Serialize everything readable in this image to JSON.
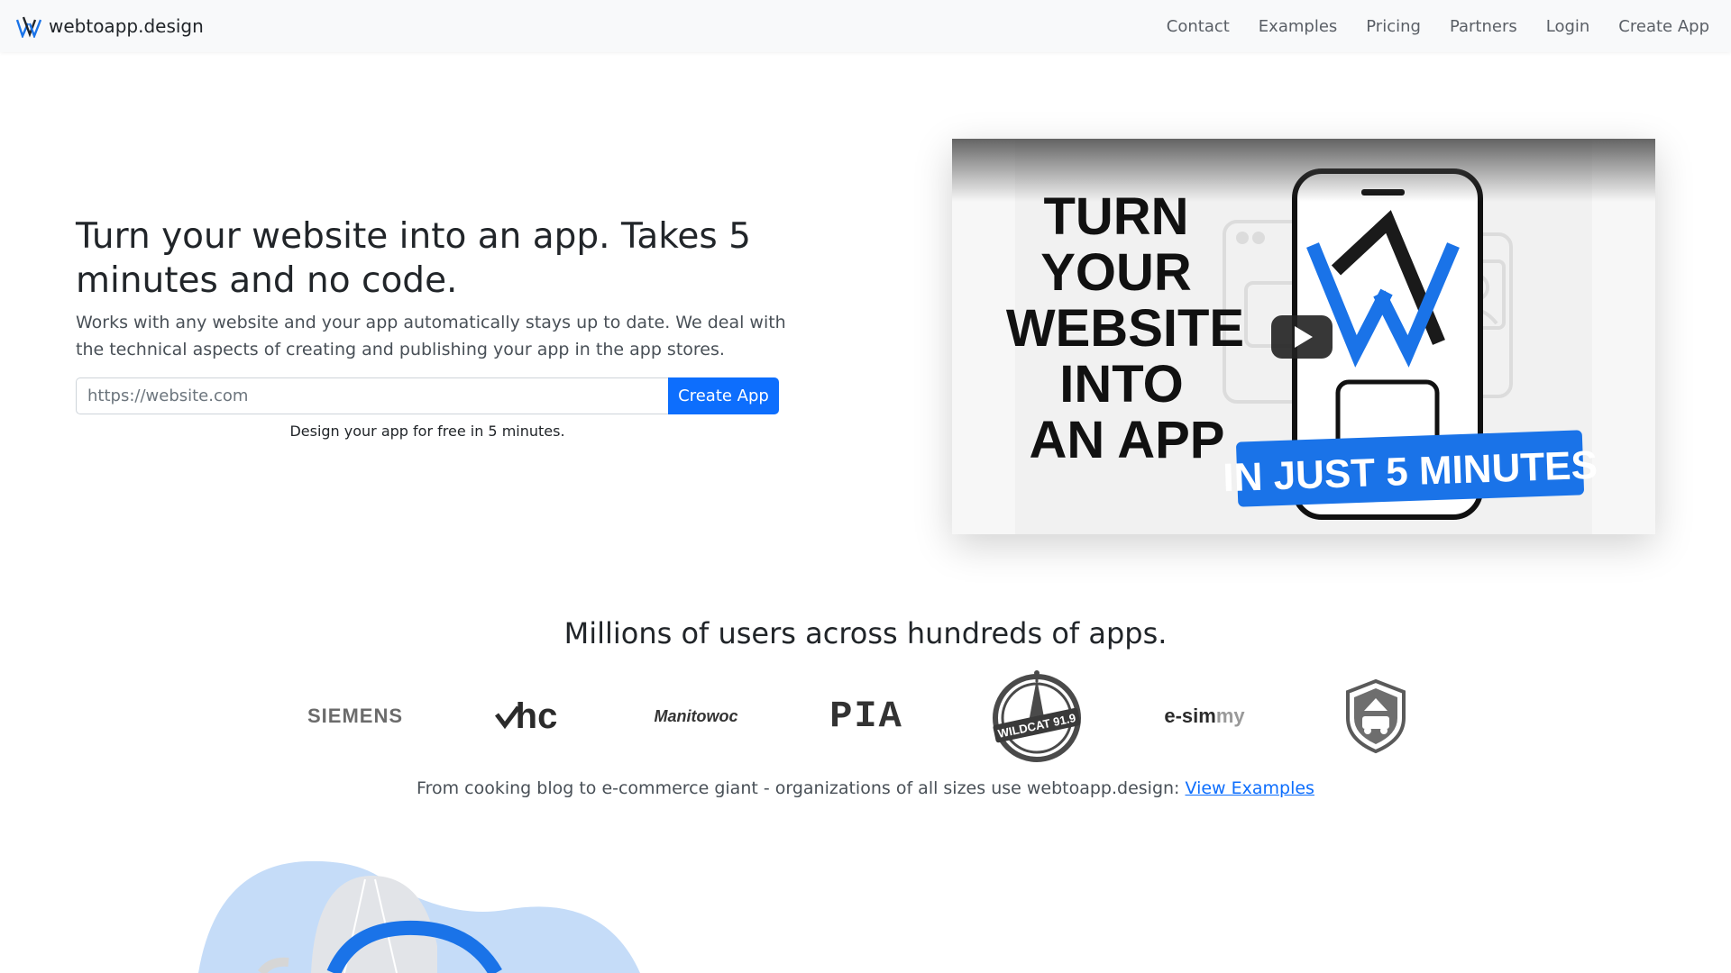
{
  "navbar": {
    "brand": "webtoapp.design",
    "links": [
      "Contact",
      "Examples",
      "Pricing",
      "Partners",
      "Login",
      "Create App"
    ]
  },
  "hero": {
    "title": "Turn your website into an app. Takes 5 minutes and no code.",
    "subtitle": "Works with any website and your app automatically stays up to date. We deal with the technical aspects of creating and publishing your app in the app stores.",
    "input_placeholder": "https://website.com",
    "button": "Create App",
    "hint": "Design your app for free in 5 minutes."
  },
  "video": {
    "headline_lines": [
      "TURN",
      "YOUR",
      "WEBSITE",
      "INTO",
      "AN APP"
    ],
    "banner": "IN JUST 5 MINUTES",
    "play_icon": "youtube-play-icon"
  },
  "users": {
    "heading": "Millions of users across hundreds of apps.",
    "logos": {
      "siemens": "SIEMENS",
      "hc": "hc",
      "manitowoc": "Manitowoc",
      "pia": "PIA",
      "wildcat": "WILDCAT 91.9",
      "esim_prefix": "e-sim",
      "esim_suffix": "my",
      "shield": "shield-van-icon"
    },
    "orgs_text": "From cooking blog to e-commerce giant - organizations of all sizes use webtoapp.design: ",
    "orgs_link": "View Examples"
  },
  "colors": {
    "accent": "#0d6efd",
    "nav_bg": "#f8f9fa",
    "logo_gray": "#6b6b6b",
    "video_blue": "#1a73e8"
  }
}
